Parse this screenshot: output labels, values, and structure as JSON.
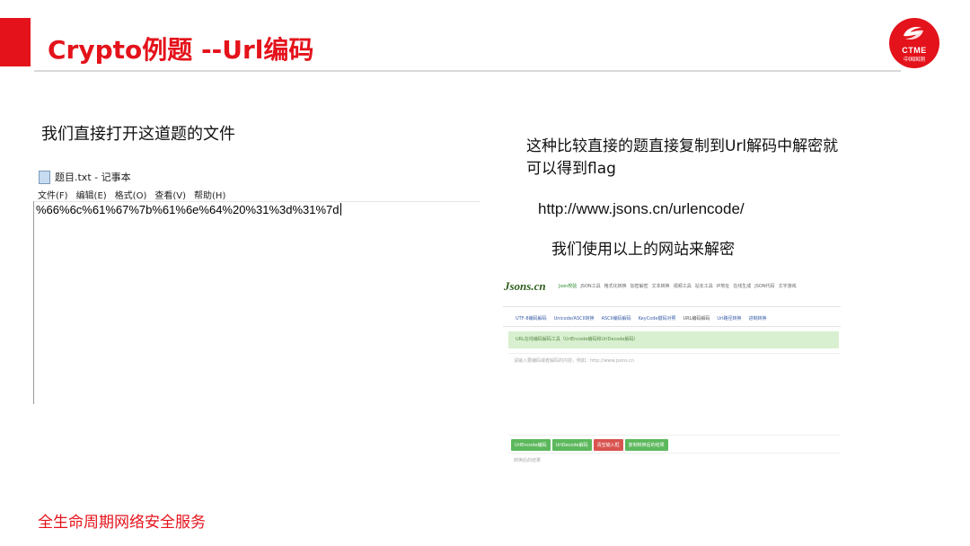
{
  "slide": {
    "title": "Crypto例题 --Url编码",
    "intro": "我们直接打开这道题的文件",
    "description": "这种比较直接的题直接复制到Url解码中解密就可以得到flag",
    "url": "http://www.jsons.cn/urlencode/",
    "usage": "我们使用以上的网站来解密",
    "footer": "全生命周期网络安全服务",
    "accent_color": "#e4121b"
  },
  "logo": {
    "brand": "CTME",
    "brand_sub": "中国国测",
    "icon": "ctme-swirl-icon"
  },
  "notepad": {
    "window_title": "题目.txt - 记事本",
    "icon": "text-file-icon",
    "menu": [
      "文件(F)",
      "编辑(E)",
      "格式(O)",
      "查看(V)",
      "帮助(H)"
    ],
    "content": "%66%6c%61%67%7b%61%6e%64%20%31%3d%31%7d"
  },
  "website": {
    "logo": "Jsons.cn",
    "nav": [
      "Json校验",
      "JSON工具",
      "格式化转换",
      "加密解密",
      "文本转换",
      "视频工具",
      "站长工具",
      "IP地址",
      "在线生成",
      "JSON代码",
      "文字游戏"
    ],
    "tabs": [
      "UTF-8编码解码",
      "Unicode/ASCII转换",
      "ASCII编码解码",
      "KeyCode键码对照",
      "URL编码解码",
      "Url路径转换",
      "进制转换"
    ],
    "active_nav": 0,
    "active_tab": 4,
    "banner": "URL在线编码解码工具（UrlEncode编码和UrlDecode解码）",
    "input_placeholder": "请输入要编码或者解码的内容，例如：http://www.jsons.cn",
    "buttons": [
      {
        "label": "UrlEncode编码",
        "color": "green"
      },
      {
        "label": "UrlDecode解码",
        "color": "green"
      },
      {
        "label": "清空输入框",
        "color": "red"
      },
      {
        "label": "复制转换后的结果",
        "color": "green"
      }
    ],
    "output_placeholder": "转换后的结果"
  }
}
